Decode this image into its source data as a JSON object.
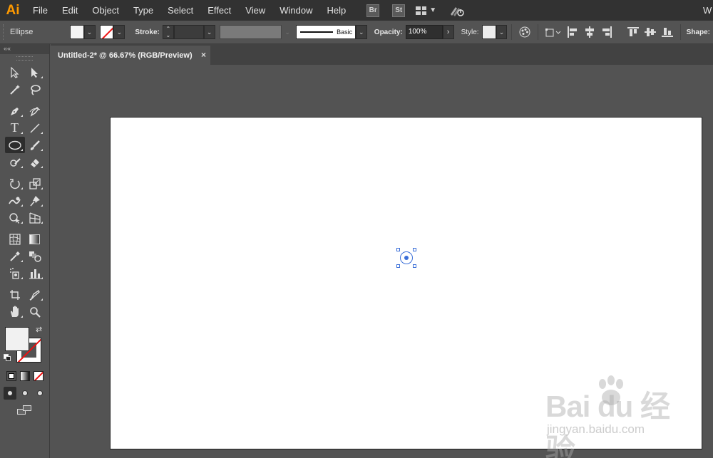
{
  "app": {
    "logo": "Ai"
  },
  "menubar": {
    "items": [
      "File",
      "Edit",
      "Object",
      "Type",
      "Select",
      "Effect",
      "View",
      "Window",
      "Help"
    ],
    "bridge_label": "Br",
    "stock_label": "St",
    "right_label": "W"
  },
  "controlbar": {
    "tool_name": "Ellipse",
    "stroke_label": "Stroke:",
    "brush_label": "Basic",
    "opacity_label": "Opacity:",
    "opacity_value": "100%",
    "style_label": "Style:",
    "shape_label": "Shape:"
  },
  "document": {
    "tab_title": "Untitled-2* @ 66.67% (RGB/Preview)",
    "close_symbol": "×"
  },
  "toolbox": {
    "collapse_symbol": "««",
    "tools": [
      [
        "selection-tool",
        "direct-selection-tool"
      ],
      [
        "magic-wand-tool",
        "lasso-tool"
      ],
      [
        "pen-tool",
        "curvature-tool"
      ],
      [
        "type-tool",
        "line-segment-tool"
      ],
      [
        "ellipse-tool",
        "paintbrush-tool"
      ],
      [
        "shaper-tool",
        "eraser-tool"
      ],
      [
        "rotate-tool",
        "scale-tool"
      ],
      [
        "warp-tool",
        "puppet-warp-tool"
      ],
      [
        "shape-builder-tool",
        "perspective-grid-tool"
      ],
      [
        "mesh-tool",
        "gradient-tool"
      ],
      [
        "eyedropper-tool",
        "blend-tool"
      ],
      [
        "symbol-sprayer-tool",
        "column-graph-tool"
      ],
      [
        "artboard-tool",
        "slice-tool"
      ],
      [
        "hand-tool",
        "zoom-tool"
      ]
    ],
    "active_tool": "ellipse-tool",
    "fill_color": "#f1f1f1",
    "stroke_color": "none"
  },
  "colors": {
    "accent": "#ff9a00",
    "selection": "#3b6fd8",
    "artboard": "#ffffff"
  },
  "watermark": {
    "logo_text": "Bai  du 经验",
    "url": "jingyan.baidu.com"
  }
}
